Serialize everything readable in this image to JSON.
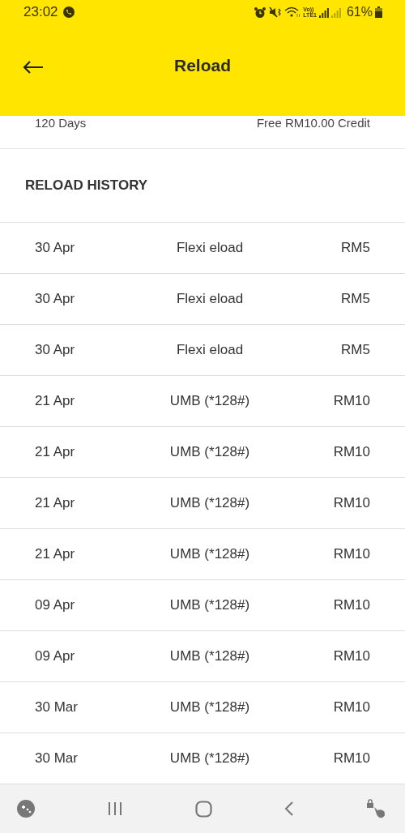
{
  "status_bar": {
    "time": "23:02",
    "volte": "Vo))",
    "network": "LTE1",
    "battery": "61%"
  },
  "header": {
    "title": "Reload"
  },
  "plan": {
    "validity": "120 Days",
    "bonus": "Free RM10.00 Credit"
  },
  "history": {
    "title": "RELOAD HISTORY",
    "rows": [
      {
        "date": "30 Apr",
        "method": "Flexi eload",
        "amount": "RM5"
      },
      {
        "date": "30 Apr",
        "method": "Flexi eload",
        "amount": "RM5"
      },
      {
        "date": "30 Apr",
        "method": "Flexi eload",
        "amount": "RM5"
      },
      {
        "date": "21 Apr",
        "method": "UMB (*128#)",
        "amount": "RM10"
      },
      {
        "date": "21 Apr",
        "method": "UMB (*128#)",
        "amount": "RM10"
      },
      {
        "date": "21 Apr",
        "method": "UMB (*128#)",
        "amount": "RM10"
      },
      {
        "date": "21 Apr",
        "method": "UMB (*128#)",
        "amount": "RM10"
      },
      {
        "date": "09 Apr",
        "method": "UMB (*128#)",
        "amount": "RM10"
      },
      {
        "date": "09 Apr",
        "method": "UMB (*128#)",
        "amount": "RM10"
      },
      {
        "date": "30 Mar",
        "method": "UMB (*128#)",
        "amount": "RM10"
      },
      {
        "date": "30 Mar",
        "method": "UMB (*128#)",
        "amount": "RM10"
      }
    ]
  }
}
